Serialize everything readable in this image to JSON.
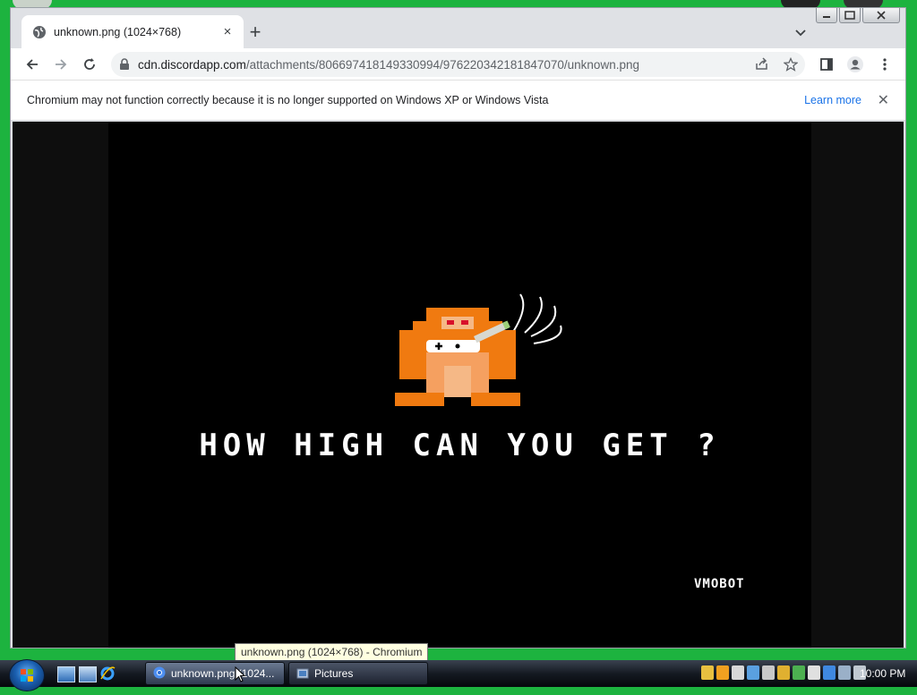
{
  "browser": {
    "tab": {
      "title": "unknown.png (1024×768)",
      "close": "×"
    },
    "new_tab": "+",
    "window_buttons": {
      "minimize": "—",
      "maximize": "▭",
      "close": "✕"
    },
    "address": {
      "host": "cdn.discordapp.com",
      "path": "/attachments/806697418149330994/976220342181847070/unknown.png"
    },
    "infobar": {
      "message": "Chromium may not function correctly because it is no longer supported on Windows XP or Windows Vista",
      "link": "Learn more",
      "close": "✕"
    },
    "image": {
      "headline": "HOW HIGH CAN YOU GET ?",
      "signature": "VMOBOT"
    },
    "tooltip": "unknown.png (1024×768) - Chromium"
  },
  "taskbar": {
    "buttons": [
      {
        "label": "unknown.png (1024..."
      },
      {
        "label": "Pictures"
      }
    ],
    "clock": "10:00 PM"
  },
  "colors": {
    "desktop": "#1db33f",
    "kong_orange": "#f07a10",
    "link": "#1a73e8"
  }
}
